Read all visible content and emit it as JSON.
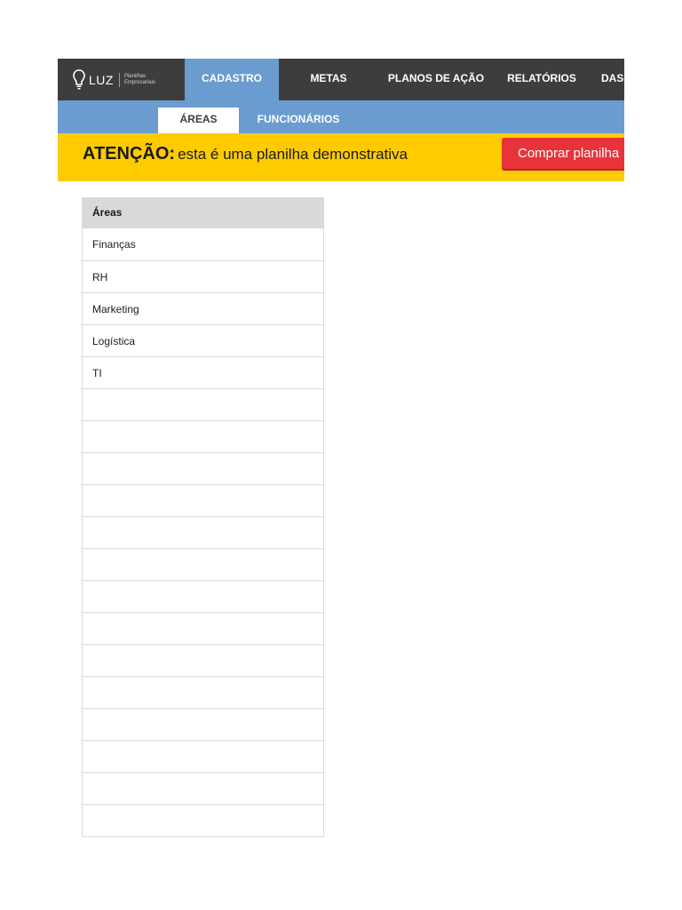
{
  "logo": {
    "name": "LUZ",
    "tagline_line1": "Planilhas",
    "tagline_line2": "Empresariais"
  },
  "nav": {
    "tabs": [
      {
        "label": "CADASTRO",
        "active": true
      },
      {
        "label": "METAS",
        "active": false
      },
      {
        "label": "PLANOS DE AÇÃO",
        "active": false
      },
      {
        "label": "RELATÓRIOS",
        "active": false
      },
      {
        "label": "DASHBOARD",
        "active": false
      }
    ]
  },
  "subnav": {
    "tabs": [
      {
        "label": "ÁREAS",
        "active": true
      },
      {
        "label": "FUNCIONÁRIOS",
        "active": false
      }
    ]
  },
  "warning": {
    "strong": "ATENÇÃO:",
    "message": "esta é uma planilha demonstrativa",
    "buy_button": "Comprar planilha"
  },
  "table": {
    "header": "Áreas",
    "rows": [
      "Finanças",
      "RH",
      "Marketing",
      "Logística",
      "TI",
      "",
      "",
      "",
      "",
      "",
      "",
      "",
      "",
      "",
      "",
      "",
      "",
      "",
      ""
    ]
  },
  "colors": {
    "topbar": "#3d3d3d",
    "accent_blue": "#6a9ccf",
    "warning_yellow": "#fecb00",
    "buy_red": "#e8333a",
    "table_header": "#d9d9d9"
  }
}
